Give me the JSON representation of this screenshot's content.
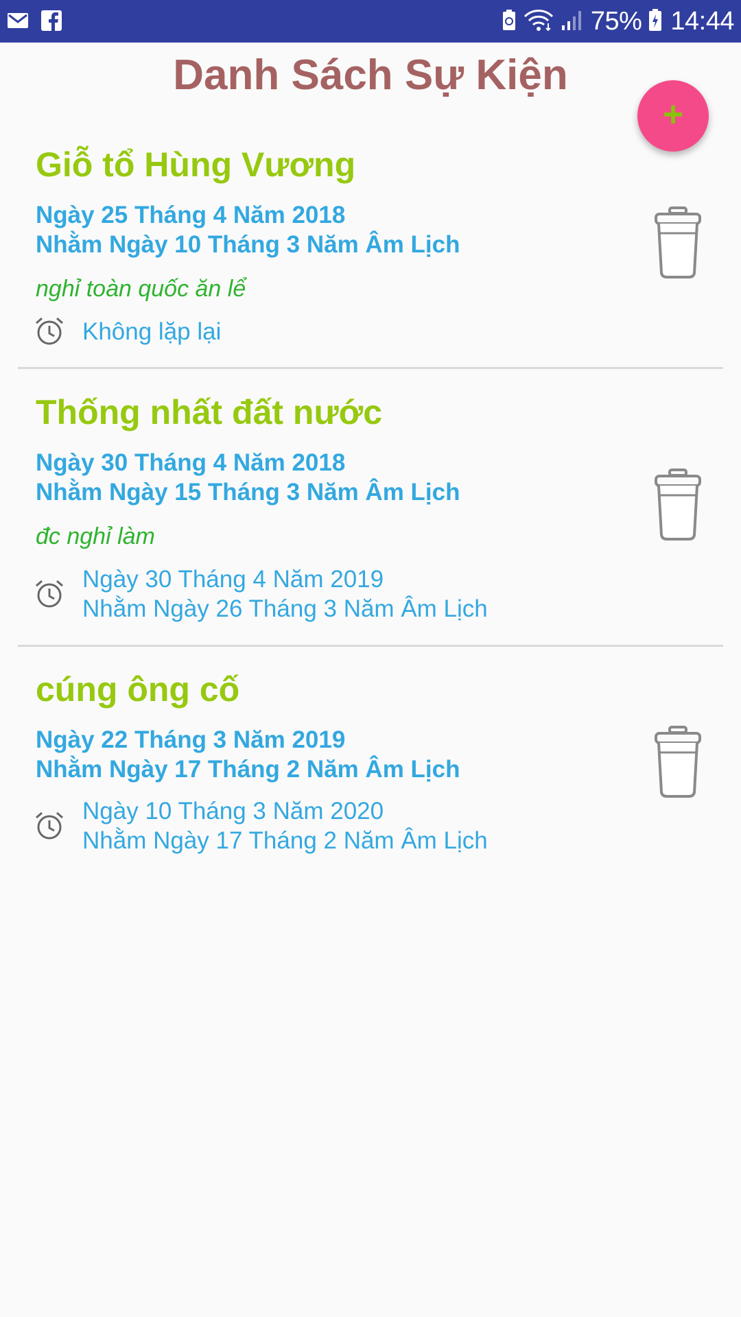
{
  "status_bar": {
    "battery": "75%",
    "time": "14:44",
    "left_icons": [
      "gmail-icon",
      "facebook-icon"
    ],
    "right_icons": [
      "battery-saver-icon",
      "wifi-icon",
      "signal-icon",
      "battery-icon"
    ]
  },
  "header": {
    "title": "Danh Sách Sự Kiện",
    "add_label": "+"
  },
  "events": [
    {
      "title": "Giỗ tổ Hùng Vương",
      "date": "Ngày 25 Tháng 4 Năm 2018",
      "lunar": "Nhằm Ngày 10 Tháng 3 Năm Âm Lịch",
      "note": "nghỉ toàn quốc ăn lể",
      "repeat": "Không lặp lại",
      "repeat_lunar": ""
    },
    {
      "title": "Thống nhất đất nước",
      "date": "Ngày 30 Tháng 4 Năm 2018",
      "lunar": "Nhằm Ngày 15 Tháng 3 Năm Âm Lịch",
      "note": "đc nghỉ làm",
      "repeat": "Ngày 30 Tháng 4 Năm 2019",
      "repeat_lunar": "Nhằm Ngày 26 Tháng 3 Năm Âm Lịch"
    },
    {
      "title": "cúng ông cố",
      "date": "Ngày 22 Tháng 3 Năm 2019",
      "lunar": "Nhằm Ngày 17 Tháng 2 Năm Âm Lịch",
      "note": "",
      "repeat": "Ngày 10 Tháng 3 Năm 2020",
      "repeat_lunar": "Nhằm Ngày 17 Tháng 2 Năm Âm Lịch"
    }
  ],
  "colors": {
    "status_bar": "#303e9f",
    "title": "#a56262",
    "event_title": "#96c90f",
    "date_text": "#33a8e0",
    "note_text": "#2fb32f",
    "fab": "#f44a8a",
    "fab_plus": "#8bc20c"
  }
}
